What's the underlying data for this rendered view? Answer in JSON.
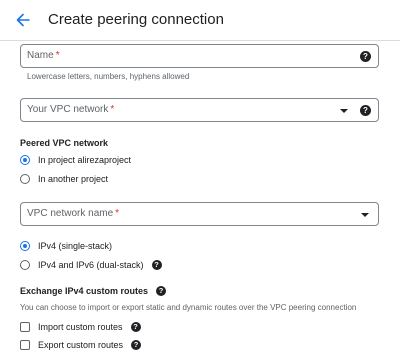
{
  "header": {
    "title": "Create peering connection"
  },
  "name_field": {
    "label": "Name",
    "required_mark": "*",
    "hint": "Lowercase letters, numbers, hyphens allowed"
  },
  "vpc_field": {
    "label": "Your VPC network",
    "required_mark": "*"
  },
  "peered": {
    "title": "Peered VPC network",
    "options": [
      {
        "label": "In project alirezaproject",
        "selected": true
      },
      {
        "label": "In another project",
        "selected": false
      }
    ]
  },
  "vpc_name_field": {
    "label": "VPC network name",
    "required_mark": "*"
  },
  "stack": {
    "options": [
      {
        "label": "IPv4 (single-stack)",
        "selected": true
      },
      {
        "label": "IPv4 and IPv6 (dual-stack)",
        "selected": false
      }
    ]
  },
  "routes": {
    "title": "Exchange IPv4 custom routes",
    "description": "You can choose to import or export static and dynamic routes over the VPC peering connection",
    "checkboxes": [
      {
        "label": "Import custom routes",
        "checked": false
      },
      {
        "label": "Export custom routes",
        "checked": false
      }
    ]
  },
  "icons": {
    "back": "arrow-back-icon",
    "help": "help-icon",
    "dropdown": "dropdown-caret-icon"
  },
  "colors": {
    "accent": "#1a73e8",
    "required": "#d93025",
    "border": "#80868b",
    "muted_text": "#5f6368"
  }
}
